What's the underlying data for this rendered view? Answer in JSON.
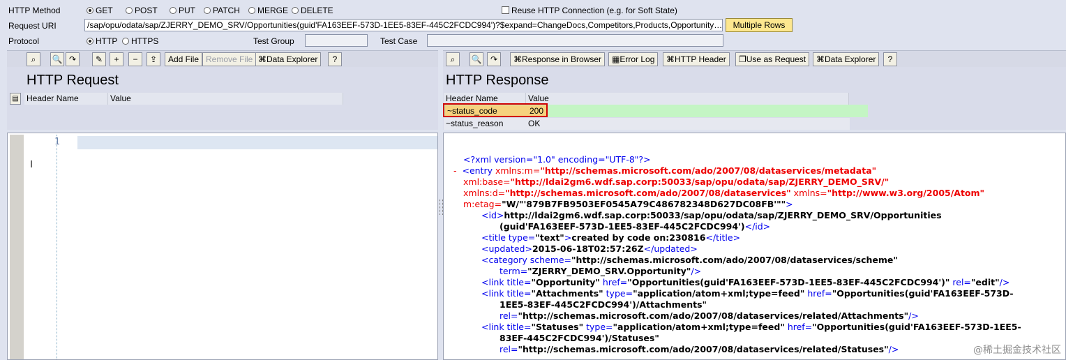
{
  "top": {
    "method_label": "HTTP Method",
    "methods": [
      "GET",
      "POST",
      "PUT",
      "PATCH",
      "MERGE",
      "DELETE"
    ],
    "reuse_label": "Reuse HTTP Connection (e.g. for Soft State)",
    "uri_label": "Request URI",
    "uri_value": "/sap/opu/odata/sap/ZJERRY_DEMO_SRV/Opportunities(guid'FA163EEF-573D-1EE5-83EF-445C2FCDC994')?$expand=ChangeDocs,Competitors,Products,Opportunity…",
    "multiple_rows": "Multiple Rows",
    "protocol_label": "Protocol",
    "protocols": [
      "HTTP",
      "HTTPS"
    ],
    "test_group_label": "Test Group",
    "test_case_label": "Test Case"
  },
  "request": {
    "toolbar": {
      "add_file": "Add File",
      "remove_file": "Remove File",
      "data_explorer": "Data Explorer"
    },
    "title": "HTTP Request",
    "col_header_name": "Header Name",
    "col_value": "Value",
    "editor_line": "1"
  },
  "response": {
    "toolbar": {
      "response_in_browser": "Response in Browser",
      "error_log": "Error Log",
      "http_header": "HTTP Header",
      "use_as_request": "Use as Request",
      "data_explorer": "Data Explorer"
    },
    "title": "HTTP Response",
    "col_header_name": "Header Name",
    "col_value": "Value",
    "rows": [
      {
        "name": "~status_code",
        "value": "200"
      },
      {
        "name": "~status_reason",
        "value": "OK"
      }
    ],
    "xml": {
      "decl": "<?xml version=\"1.0\" encoding=\"UTF-8\"?>",
      "minus": "-",
      "entry_open": "<entry",
      "xmlns_m_attr": "xmlns:m=",
      "xmlns_m_val": "\"http://schemas.microsoft.com/ado/2007/08/dataservices/metadata\"",
      "base_attr": "xml:base=",
      "base_val": "\"http://ldai2gm6.wdf.sap.corp:50033/sap/opu/odata/sap/ZJERRY_DEMO_SRV/\"",
      "xmlns_d_attr": "xmlns:d=",
      "xmlns_d_val": "\"http://schemas.microsoft.com/ado/2007/08/dataservices\"",
      "xmlns_attr": "xmlns=",
      "xmlns_val": "\"http://www.w3.org/2005/Atom\"",
      "etag_attr": "m:etag=",
      "etag_val": "\"W/\"'879B7FB9503EF0545A79C486782348D627DC08FB'\"\"",
      "etag_close": ">",
      "id_open": "<id>",
      "id_text1": "http://ldai2gm6.wdf.sap.corp:50033/sap/opu/odata/sap/ZJERRY_DEMO_SRV/Opportunities",
      "id_text2": "(guid'FA163EEF-573D-1EE5-83EF-445C2FCDC994')",
      "id_close": "</id>",
      "title_open": "<title type=",
      "title_type": "\"text\"",
      "title_gt": ">",
      "title_text": "created by code on:230816",
      "title_close": "</title>",
      "updated_open": "<updated>",
      "updated_text": "2015-06-18T02:57:26Z",
      "updated_close": "</updated>",
      "cat_open": "<category scheme=",
      "cat_scheme": "\"http://schemas.microsoft.com/ado/2007/08/dataservices/scheme\"",
      "cat_term_attr": "term=",
      "cat_term": "\"ZJERRY_DEMO_SRV.Opportunity\"",
      "cat_close": "/>",
      "link1_open": "<link title=",
      "link1_title": "\"Opportunity\"",
      "link1_href_attr": " href=",
      "link1_href": "\"Opportunities(guid'FA163EEF-573D-1EE5-83EF-445C2FCDC994')\"",
      "link1_rel_attr": " rel=",
      "link1_rel": "\"edit\"",
      "link1_close": "/>",
      "link2_open": "<link title=",
      "link2_title": "\"Attachments\"",
      "link2_type_attr": " type=",
      "link2_type": "\"application/atom+xml;type=feed\"",
      "link2_href_attr": " href=",
      "link2_href1": "\"Opportunities(guid'FA163EEF-573D-",
      "link2_href2": "1EE5-83EF-445C2FCDC994')/Attachments\"",
      "link2_rel_attr": "rel=",
      "link2_rel": "\"http://schemas.microsoft.com/ado/2007/08/dataservices/related/Attachments\"",
      "link2_close": "/>",
      "link3_open": "<link title=",
      "link3_title": "\"Statuses\"",
      "link3_type_attr": " type=",
      "link3_type": "\"application/atom+xml;type=feed\"",
      "link3_href_attr": " href=",
      "link3_href1": "\"Opportunities(guid'FA163EEF-573D-1EE5-",
      "link3_href2": "83EF-445C2FCDC994')/Statuses\"",
      "link3_rel_attr": "rel=",
      "link3_rel": "\"http://schemas.microsoft.com/ado/2007/08/dataservices/related/Statuses\"",
      "link3_close": "/>"
    }
  },
  "watermark": "@稀土掘金技术社区",
  "colors": {
    "status_row_bg": "#c4f5c4",
    "selected_name_bg": "#f6d27e",
    "highlight_border": "#d20000",
    "button_yellow": "#fde78f"
  }
}
